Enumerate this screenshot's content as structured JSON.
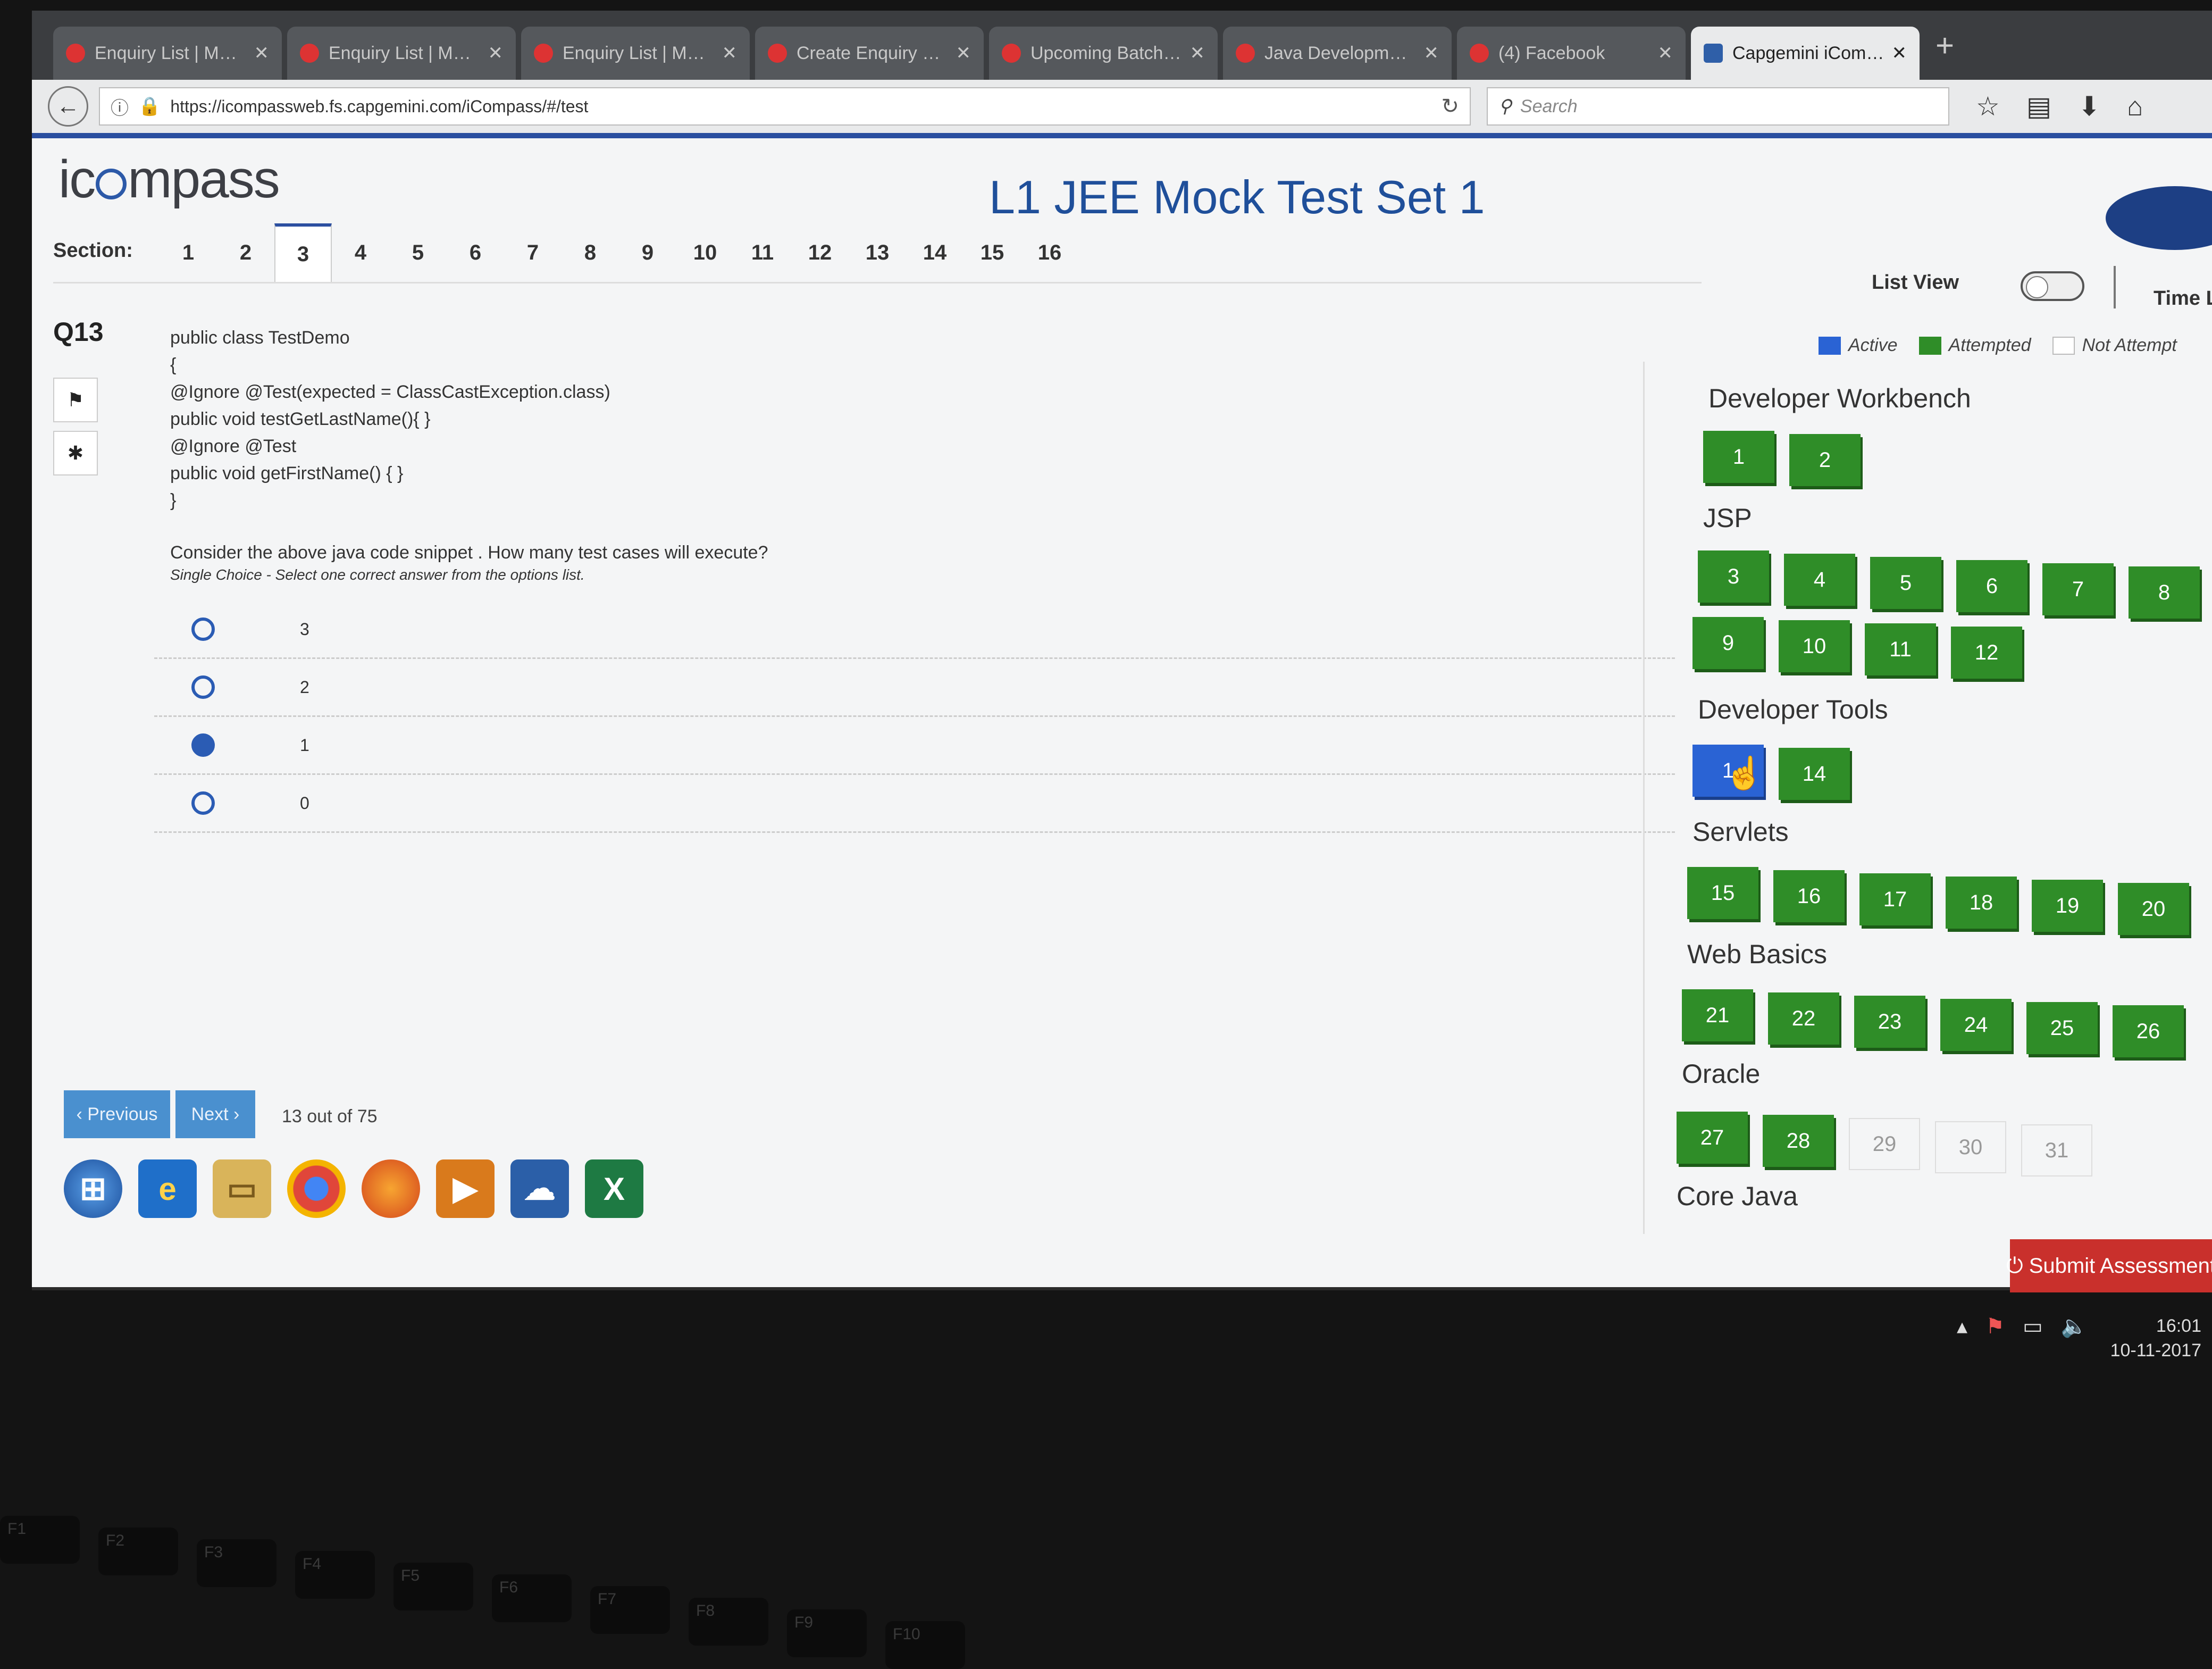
{
  "browser": {
    "tabs": [
      {
        "title": "Enquiry List | Manage",
        "active": false
      },
      {
        "title": "Enquiry List | Manage",
        "active": false
      },
      {
        "title": "Enquiry List | Manage",
        "active": false
      },
      {
        "title": "Create Enquiry Form |",
        "active": false
      },
      {
        "title": "Upcoming Batches - E",
        "active": false
      },
      {
        "title": "Java Development Tra",
        "active": false
      },
      {
        "title": "(4) Facebook",
        "active": false
      },
      {
        "title": "Capgemini iCompass",
        "active": true
      }
    ],
    "close_glyph": "✕",
    "new_tab_glyph": "+",
    "url": "https://icompassweb.fs.capgemini.com/iCompass/#/test",
    "search_placeholder": "Search"
  },
  "app": {
    "logo_pre": "ic",
    "logo_post": "mpass",
    "title": "L1 JEE Mock Test Set 1",
    "section_label": "Section:",
    "sections": [
      "1",
      "2",
      "3",
      "4",
      "5",
      "6",
      "7",
      "8",
      "9",
      "10",
      "11",
      "12",
      "13",
      "14",
      "15",
      "16"
    ],
    "active_section": "3",
    "list_view_label": "List View",
    "time_left_label": "Time Lef"
  },
  "question": {
    "number": "Q13",
    "code_lines": [
      "public class TestDemo",
      "{",
      "@Ignore @Test(expected = ClassCastException.class)",
      "public void testGetLastName(){ }",
      "@Ignore @Test",
      "public void getFirstName() { }",
      "}"
    ],
    "prompt": "Consider the above java code snippet . How many test cases will execute?",
    "instruction": "Single Choice - Select one correct answer from the options list.",
    "options": [
      {
        "label": "3",
        "selected": false
      },
      {
        "label": "2",
        "selected": false
      },
      {
        "label": "1",
        "selected": true
      },
      {
        "label": "0",
        "selected": false
      }
    ]
  },
  "legend": {
    "active": "Active",
    "attempted": "Attempted",
    "not_attempted": "Not Attempt"
  },
  "navigator": {
    "groups": [
      {
        "name": "Developer Workbench",
        "questions": [
          {
            "n": "1",
            "s": "attempted"
          },
          {
            "n": "2",
            "s": "attempted"
          }
        ]
      },
      {
        "name": "JSP",
        "questions": [
          {
            "n": "3",
            "s": "attempted"
          },
          {
            "n": "4",
            "s": "attempted"
          },
          {
            "n": "5",
            "s": "attempted"
          },
          {
            "n": "6",
            "s": "attempted"
          },
          {
            "n": "7",
            "s": "attempted"
          },
          {
            "n": "8",
            "s": "attempted"
          },
          {
            "n": "9",
            "s": "attempted"
          },
          {
            "n": "10",
            "s": "attempted"
          },
          {
            "n": "11",
            "s": "attempted"
          },
          {
            "n": "12",
            "s": "attempted"
          }
        ]
      },
      {
        "name": "Developer Tools",
        "questions": [
          {
            "n": "1",
            "s": "active"
          },
          {
            "n": "14",
            "s": "attempted"
          }
        ]
      },
      {
        "name": "Servlets",
        "questions": [
          {
            "n": "15",
            "s": "attempted"
          },
          {
            "n": "16",
            "s": "attempted"
          },
          {
            "n": "17",
            "s": "attempted"
          },
          {
            "n": "18",
            "s": "attempted"
          },
          {
            "n": "19",
            "s": "attempted"
          },
          {
            "n": "20",
            "s": "attempted"
          }
        ]
      },
      {
        "name": "Web Basics",
        "questions": [
          {
            "n": "21",
            "s": "attempted"
          },
          {
            "n": "22",
            "s": "attempted"
          },
          {
            "n": "23",
            "s": "attempted"
          },
          {
            "n": "24",
            "s": "attempted"
          },
          {
            "n": "25",
            "s": "attempted"
          },
          {
            "n": "26",
            "s": "attempted"
          }
        ]
      },
      {
        "name": "Oracle",
        "questions": [
          {
            "n": "27",
            "s": "attempted"
          },
          {
            "n": "28",
            "s": "attempted"
          },
          {
            "n": "29",
            "s": "not_attempted"
          },
          {
            "n": "30",
            "s": "not_attempted"
          },
          {
            "n": "31",
            "s": "not_attempted"
          }
        ]
      },
      {
        "name": "Core Java",
        "questions": []
      }
    ]
  },
  "footer": {
    "previous": "‹ Previous",
    "next": "Next ›",
    "counter": "13 out of 75",
    "submit": "⏻ Submit Assessment"
  },
  "system": {
    "time": "16:01",
    "date": "10-11-2017",
    "function_keys": [
      "F1",
      "F2",
      "F3",
      "F4",
      "F5",
      "F6",
      "F7",
      "F8",
      "F9",
      "F10"
    ]
  },
  "colors": {
    "active": "#2a63d4",
    "attempted": "#2f8d28",
    "title": "#1f4f9a",
    "submit": "#c9302c"
  }
}
